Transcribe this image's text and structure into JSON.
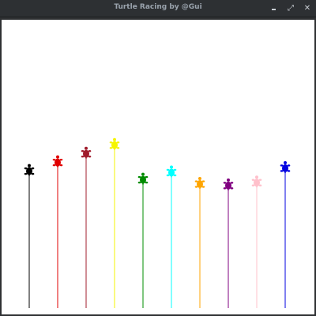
{
  "window": {
    "title": "Turtle Racing by @Gui",
    "minimize_icon": "minimize-icon",
    "maximize_icon": "maximize-icon",
    "close_icon": "close-icon",
    "close_glyph": "✕",
    "maximize_glyph": "⤢"
  },
  "race": {
    "turtles": [
      {
        "color": "#000000",
        "progress": 0.475
      },
      {
        "color": "#e00000",
        "progress": 0.505
      },
      {
        "color": "#a01c2c",
        "progress": 0.535
      },
      {
        "color": "#f5f500",
        "progress": 0.565
      },
      {
        "color": "#008c00",
        "progress": 0.445
      },
      {
        "color": "#00ffff",
        "progress": 0.47
      },
      {
        "color": "#ffa500",
        "progress": 0.43
      },
      {
        "color": "#800080",
        "progress": 0.425
      },
      {
        "color": "#ffc0cb",
        "progress": 0.435
      },
      {
        "color": "#0000e0",
        "progress": 0.485
      }
    ]
  }
}
